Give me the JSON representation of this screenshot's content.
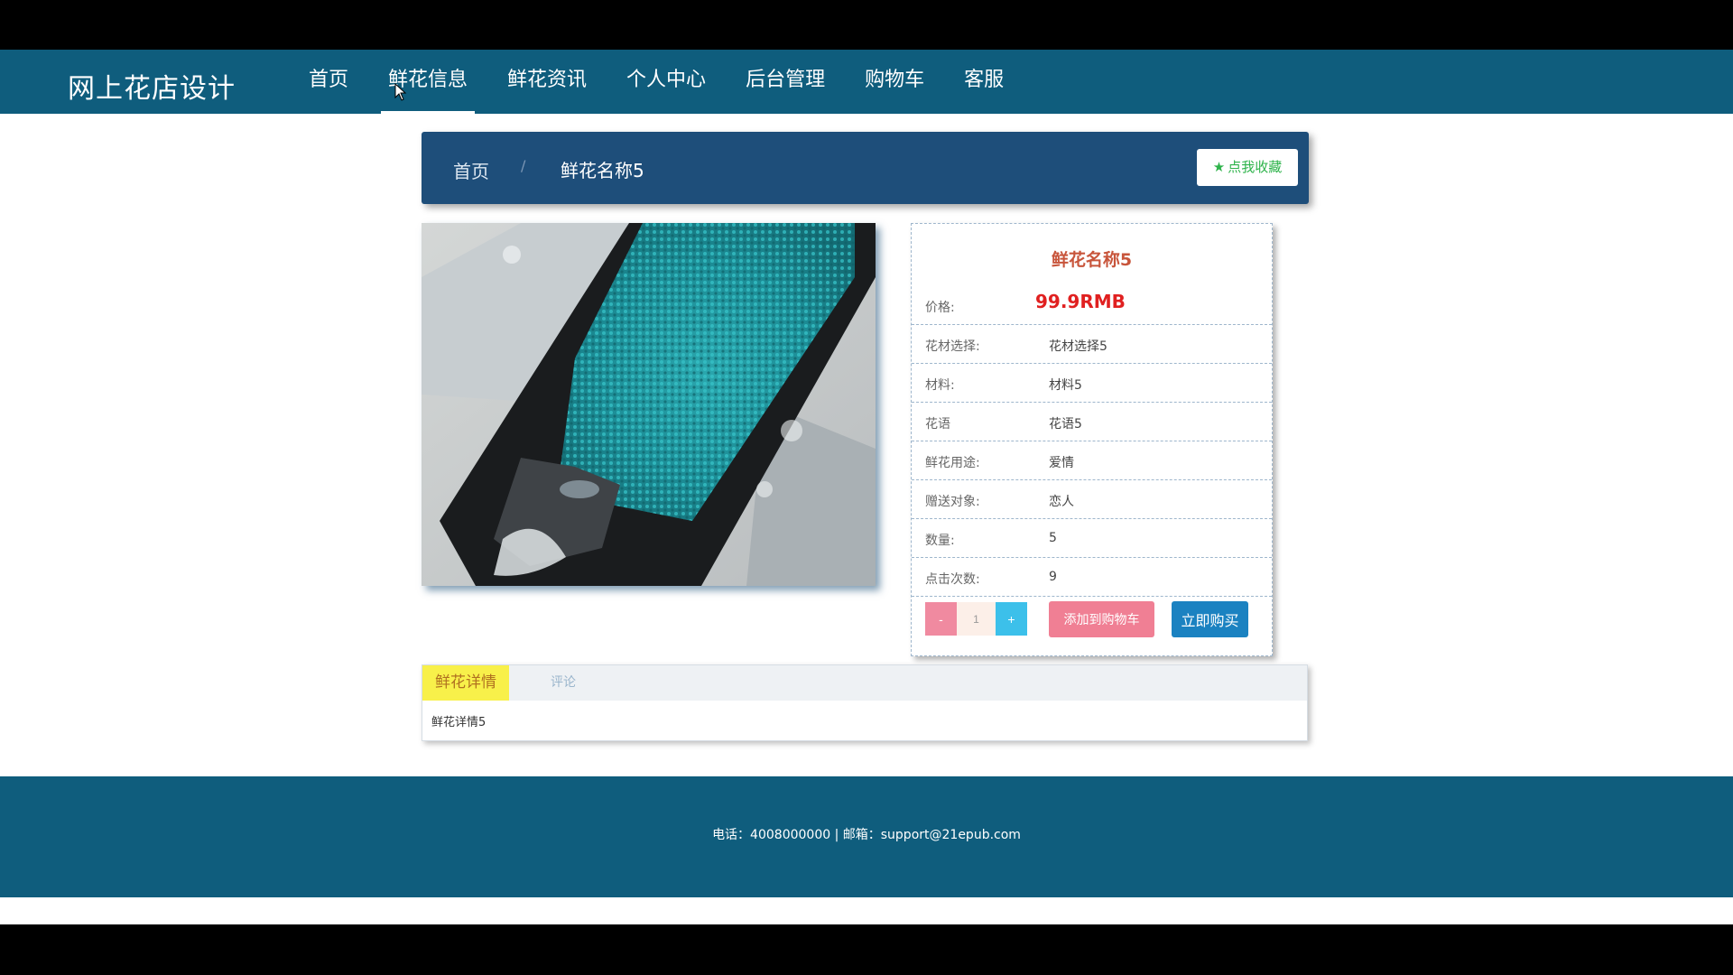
{
  "header": {
    "brand": "网上花店设计",
    "nav": [
      "首页",
      "鲜花信息",
      "鲜花资讯",
      "个人中心",
      "后台管理",
      "购物车",
      "客服"
    ],
    "active_nav_index": 1
  },
  "breadcrumb": {
    "home": "首页",
    "separator": "/",
    "current": "鲜花名称5",
    "favorite_label": "点我收藏"
  },
  "product": {
    "name": "鲜花名称5",
    "price_label": "价格:",
    "price": "99.9RMB",
    "rows": [
      {
        "label": "花材选择:",
        "value": "花材选择5"
      },
      {
        "label": "材料:",
        "value": "材料5"
      },
      {
        "label": "花语",
        "value": "花语5"
      },
      {
        "label": "鲜花用途:",
        "value": "爱情"
      },
      {
        "label": "赠送对象:",
        "value": "恋人"
      },
      {
        "label": "数量:",
        "value": "5"
      },
      {
        "label": "点击次数:",
        "value": "9"
      }
    ],
    "quantity": "1",
    "minus_label": "-",
    "plus_label": "+",
    "add_to_cart_label": "添加到购物车",
    "buy_now_label": "立即购买"
  },
  "tabs": {
    "items": [
      "鲜花详情",
      "评论"
    ],
    "active_index": 0,
    "content": "鲜花详情5"
  },
  "footer": {
    "text": "电话：4008000000 | 邮箱：support@21epub.com"
  },
  "colors": {
    "header_bg": "#0f5d7d",
    "breadcrumb_bg": "#1e4e7a",
    "price": "#e02020",
    "title": "#c8553b",
    "favorite": "#2db34a",
    "tab_active": "#f8f04a"
  }
}
